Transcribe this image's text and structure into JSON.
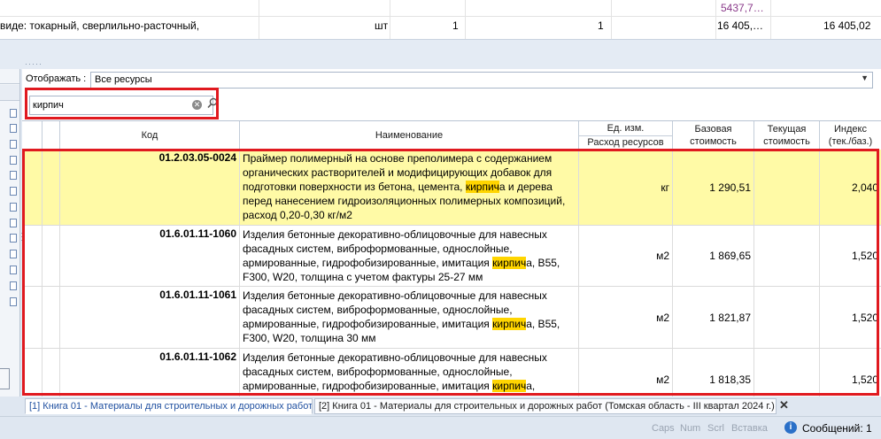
{
  "top_sheet": {
    "row1": {
      "amount": "5437,7…"
    },
    "row2": {
      "text": "виде: токарный, сверлильно-расточный,",
      "unit": "шт",
      "qty1": "1",
      "qty2": "1",
      "price": "16 405,…",
      "total": "16 405,02"
    }
  },
  "display_filter": {
    "label": "Отображать :",
    "value": "Все ресурсы"
  },
  "search": {
    "value": "кирпич",
    "placeholder": ""
  },
  "table": {
    "headers": {
      "code": "Код",
      "name": "Наименование",
      "unit_top": "Ед. изм.",
      "unit_bottom": "Расход ресурсов",
      "base_cost": [
        "Базовая",
        "стоимость"
      ],
      "current_cost": [
        "Текущая",
        "стоимость"
      ],
      "index": [
        "Индекс",
        "(тек./баз.)"
      ]
    },
    "rows": [
      {
        "code": "01.2.03.05-0024",
        "name_pre": "Праймер полимерный на основе преполимера с содержанием органических растворителей и модифицирующих добавок для подготовки поверхности из бетона, цемента, ",
        "name_hl": "кирпич",
        "name_post": "а и дерева перед нанесением гидроизоляционных полимерных композиций, расход 0,20-0,30 кг/м2",
        "unit": "кг",
        "base_cost": "1 290,51",
        "current_cost": "",
        "index": "2,040",
        "selected": true
      },
      {
        "code": "01.6.01.11-1060",
        "name_pre": "Изделия бетонные декоративно-облицовочные для навесных фасадных систем, виброформованные, однослойные, армированные, гидрофобизированные, имитация ",
        "name_hl": "кирпич",
        "name_post": "а, B55, F300, W20, толщина с учетом фактуры 25-27 мм",
        "unit": "м2",
        "base_cost": "1 869,65",
        "current_cost": "",
        "index": "1,520",
        "selected": false
      },
      {
        "code": "01.6.01.11-1061",
        "name_pre": "Изделия бетонные декоративно-облицовочные для навесных фасадных систем, виброформованные, однослойные, армированные, гидрофобизированные, имитация ",
        "name_hl": "кирпич",
        "name_post": "а, B55, F300, W20, толщина 30 мм",
        "unit": "м2",
        "base_cost": "1 821,87",
        "current_cost": "",
        "index": "1,520",
        "selected": false
      },
      {
        "code": "01.6.01.11-1062",
        "name_pre": "Изделия бетонные декоративно-облицовочные для навесных фасадных систем, виброформованные, однослойные, армированные, гидрофобизированные, имитация ",
        "name_hl": "кирпич",
        "name_post": "а,",
        "unit": "м2",
        "base_cost": "1 818,35",
        "current_cost": "",
        "index": "1,520",
        "selected": false
      }
    ]
  },
  "tabs": [
    {
      "label": "[1] Книга 01 - Материалы для строительных и дорожных работ",
      "active": true
    },
    {
      "label": "[2] Книга 01 - Материалы для строительных и дорожных работ (Томская область - III квартал 2024 г.)",
      "active": false
    }
  ],
  "status_bar": {
    "indicators": [
      "Caps",
      "Num",
      "Scrl",
      "Вставка"
    ],
    "messages_label": "Сообщений: 1"
  },
  "colors": {
    "highlight": "#ffd500",
    "selected_row": "#fffaa6",
    "annotation_red": "#e0191f",
    "tab_active_text": "#2050a0"
  },
  "icons": {
    "clear": "clear-icon",
    "search": "search-icon",
    "close_tab": "close-icon",
    "info": "info-icon",
    "dropdown": "chevron-down-icon"
  }
}
